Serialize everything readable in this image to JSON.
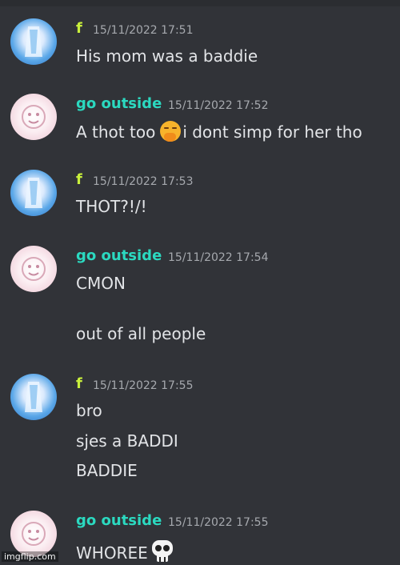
{
  "messages": [
    {
      "author": "f",
      "timestamp": "15/11/2022 17:51",
      "lines": [
        "His mom was a baddie"
      ]
    },
    {
      "author": "go outside",
      "timestamp": "15/11/2022 17:52",
      "line_before_emoji": "A thot too",
      "emoji": "yawning-face-emoji",
      "line_after_emoji": "i dont simp for her tho"
    },
    {
      "author": "f",
      "timestamp": "15/11/2022 17:53",
      "lines": [
        "THOT?!/!"
      ]
    },
    {
      "author": "go outside",
      "timestamp": "15/11/2022 17:54",
      "lines": [
        "CMON",
        "out of all people"
      ]
    },
    {
      "author": "f",
      "timestamp": "15/11/2022 17:55",
      "lines": [
        "bro",
        "sjes a BADDI",
        "BADDIE"
      ]
    },
    {
      "author": "go outside",
      "timestamp": "15/11/2022 17:55",
      "line_before_emoji": "WHOREE",
      "emoji": "skull-emoji"
    }
  ],
  "watermark": "imgflip.com",
  "colors": {
    "background": "#313338",
    "author_f": "#c9f03c",
    "author_go_outside": "#2bd9c0",
    "timestamp": "#a6a9ae",
    "text": "#e2e4e7"
  }
}
